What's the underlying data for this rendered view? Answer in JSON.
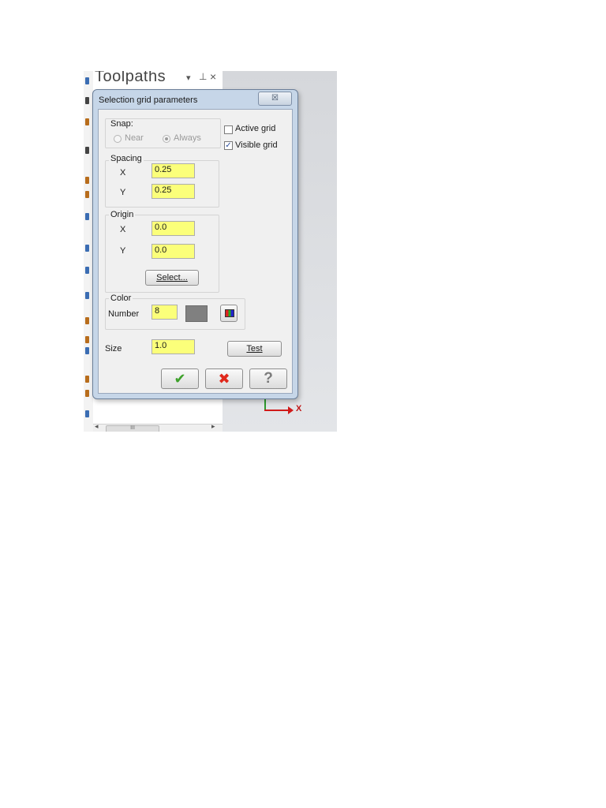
{
  "panel": {
    "title": "Toolpaths",
    "pin_arrow_icon": "▾",
    "pin_icon": "ꟷ",
    "close_icon": "×",
    "scroll_thumb_grip": "III",
    "scroll_left_icon": "◂",
    "scroll_right_icon": "▸"
  },
  "viewport": {
    "axis_label": "X",
    "x_axis_color": "#d01a1a",
    "y_axis_color": "#2e9b2e"
  },
  "dialog": {
    "title": "Selection grid parameters",
    "close_glyph": "☒",
    "snap": {
      "label": "Snap:",
      "near_label": "Near",
      "always_label": "Always",
      "selected": "Always",
      "enabled": false
    },
    "active_grid": {
      "label": "Active grid",
      "checked": false
    },
    "visible_grid": {
      "label": "Visible grid",
      "checked": true,
      "check_glyph": "✓"
    },
    "spacing": {
      "label": "Spacing",
      "x_label": "X",
      "x_value": "0.25",
      "y_label": "Y",
      "y_value": "0.25"
    },
    "origin": {
      "label": "Origin",
      "x_label": "X",
      "x_value": "0.0",
      "y_label": "Y",
      "y_value": "0.0"
    },
    "select_button": "Select...",
    "color": {
      "label": "Color",
      "number_label": "Number",
      "number_value": "8",
      "swatch": "#808080"
    },
    "size": {
      "label": "Size",
      "value": "1.0"
    },
    "test_button": "Test",
    "ok_icon": "✔",
    "cancel_icon": "✖",
    "help_icon": "?",
    "field_color": "#fbff7a"
  }
}
